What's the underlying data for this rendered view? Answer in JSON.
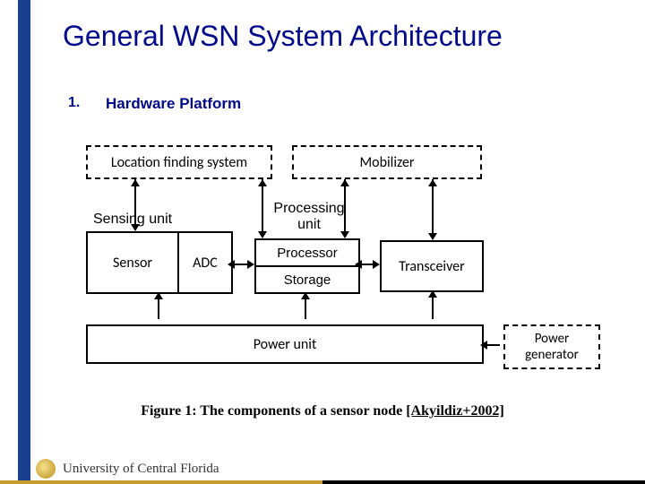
{
  "title": "General WSN System Architecture",
  "list": {
    "num": "1.",
    "label": "Hardware Platform"
  },
  "diagram": {
    "location_finding": "Location finding system",
    "mobilizer": "Mobilizer",
    "sensing_unit": "Sensing unit",
    "sensor": "Sensor",
    "adc": "ADC",
    "processing_unit": "Processing\nunit",
    "processor": "Processor",
    "storage": "Storage",
    "transceiver": "Transceiver",
    "power_unit": "Power unit",
    "power_generator": "Power\ngenerator"
  },
  "caption": {
    "text": "Figure 1: The components of a sensor node",
    "citation": "[Akyildiz+2002]"
  },
  "footer": {
    "university": "University of Central Florida"
  },
  "chart_data": {
    "type": "table",
    "title": "Components of a sensor node",
    "nodes": [
      {
        "id": "location_finding",
        "label": "Location finding system",
        "optional": true
      },
      {
        "id": "mobilizer",
        "label": "Mobilizer",
        "optional": true
      },
      {
        "id": "sensing_unit",
        "label": "Sensing unit",
        "children": [
          "Sensor",
          "ADC"
        ]
      },
      {
        "id": "processing_unit",
        "label": "Processing unit",
        "children": [
          "Processor",
          "Storage"
        ]
      },
      {
        "id": "transceiver",
        "label": "Transceiver"
      },
      {
        "id": "power_unit",
        "label": "Power unit"
      },
      {
        "id": "power_generator",
        "label": "Power generator",
        "optional": true
      }
    ],
    "edges": [
      [
        "location_finding",
        "sensing_unit"
      ],
      [
        "location_finding",
        "processing_unit"
      ],
      [
        "mobilizer",
        "processing_unit"
      ],
      [
        "mobilizer",
        "transceiver"
      ],
      [
        "sensing_unit",
        "processing_unit"
      ],
      [
        "processing_unit",
        "transceiver"
      ],
      [
        "power_unit",
        "sensing_unit"
      ],
      [
        "power_unit",
        "processing_unit"
      ],
      [
        "power_unit",
        "transceiver"
      ],
      [
        "power_generator",
        "power_unit"
      ]
    ]
  }
}
